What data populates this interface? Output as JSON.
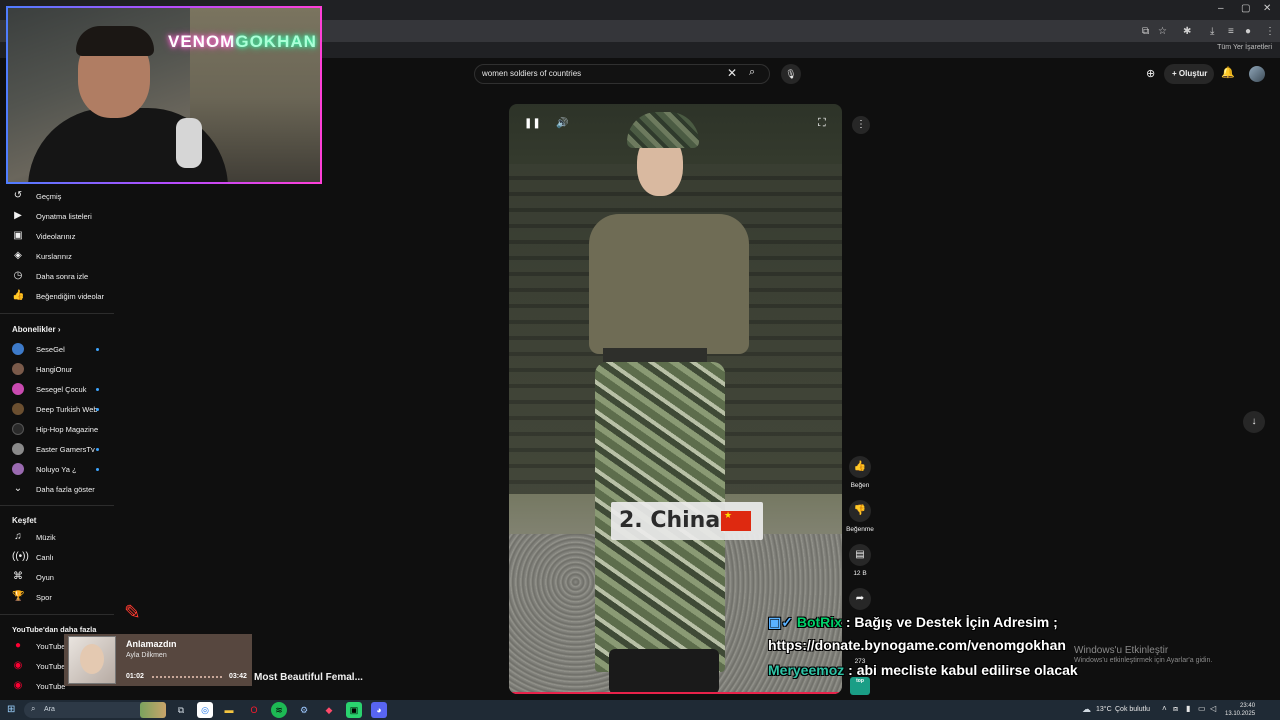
{
  "search": {
    "query": "women soldiers of countries"
  },
  "header": {
    "create_label": "Oluştur"
  },
  "bookmarks": {
    "all_label": "Tüm Yer İşaretleri"
  },
  "webcam": {
    "neon_text_1": "VENOM",
    "neon_text_2": "GOKHAN"
  },
  "sidebar": {
    "you_items": [
      {
        "label": "Geçmiş",
        "icon": "history-icon"
      },
      {
        "label": "Oynatma listeleri",
        "icon": "playlist-icon"
      },
      {
        "label": "Videolarınız",
        "icon": "video-icon"
      },
      {
        "label": "Kurslarınız",
        "icon": "course-icon"
      },
      {
        "label": "Daha sonra izle",
        "icon": "clock-icon"
      },
      {
        "label": "Beğendiğim videolar",
        "icon": "thumbs-up-icon"
      }
    ],
    "subscriptions_title": "Abonelikler",
    "subscriptions": [
      {
        "label": "SeseGel",
        "color": "#3d7ac9",
        "dot": true
      },
      {
        "label": "HangiOnur",
        "color": "#7a5a4a",
        "dot": false
      },
      {
        "label": "Sesegel Çocuk",
        "color": "#c94ab0",
        "dot": true
      },
      {
        "label": "Deep Turkish Web",
        "color": "#6b4f30",
        "dot": true
      },
      {
        "label": "Hip-Hop Magazine",
        "color": "#2a2a2a",
        "dot": false
      },
      {
        "label": "Easter GamersTv",
        "color": "#8a8a8a",
        "dot": true
      },
      {
        "label": "Noluyo Ya ¿",
        "color": "#9a6ab0",
        "dot": true
      }
    ],
    "show_more": "Daha fazla göster",
    "explore_title": "Keşfet",
    "explore": [
      {
        "label": "Müzik",
        "icon": "music-icon"
      },
      {
        "label": "Canlı",
        "icon": "live-icon"
      },
      {
        "label": "Oyun",
        "icon": "gaming-icon"
      },
      {
        "label": "Spor",
        "icon": "sports-icon"
      }
    ],
    "more_from_title": "YouTube'dan daha fazla",
    "more_from": [
      "YouTube",
      "YouTube",
      "YouTube"
    ]
  },
  "video": {
    "caption": "2. China"
  },
  "actions": {
    "like_label": "Beğen",
    "dislike_label": "Beğenme",
    "comments_count": "12 B",
    "share_count": "273"
  },
  "chat": {
    "line1_user": "BotRix",
    "line1_text": " : Bağış ve Destek İçin Adresim ;",
    "line2_text": "https://donate.bynogame.com/venomgokhan",
    "line3_user": "Meryeemoz",
    "line3_text": " : abi mecliste kabul edilirse olacak"
  },
  "windows_activation": {
    "title": "Windows'u Etkinleştir",
    "subtitle": "Windows'u etkinleştirmek için Ayarlar'a gidin."
  },
  "music_player": {
    "title": "Anlamazdın",
    "artist": "Ayla Dilkmen",
    "time_current": "01:02",
    "time_total": "03:42",
    "progress": 0.28
  },
  "next_video_title": "Most Beautiful Femal...",
  "taskbar": {
    "search_label": "Ara",
    "temperature": "13°C",
    "weather": "Çok bulutlu",
    "time": "23:40",
    "date": "13.10.2025"
  }
}
